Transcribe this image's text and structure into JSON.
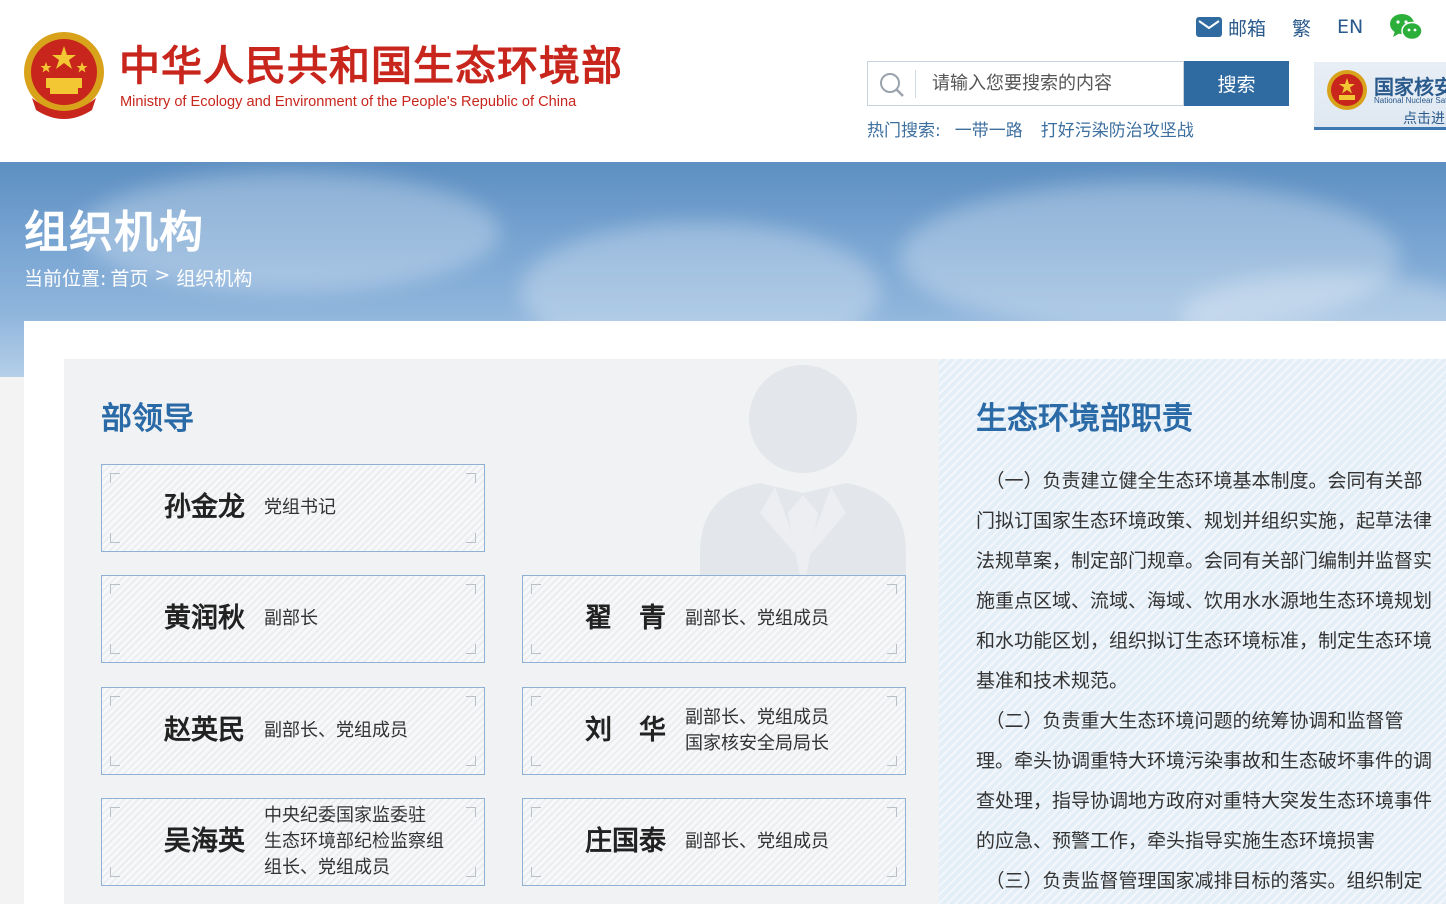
{
  "header": {
    "site_title": "中华人民共和国生态环境部",
    "site_subtitle": "Ministry of Ecology and Environment of the People's Republic of China",
    "top_links": {
      "mail": "邮箱",
      "traditional": "繁",
      "english": "EN"
    },
    "search": {
      "placeholder": "请输入您要搜索的内容",
      "button": "搜索"
    },
    "hot_search": {
      "label": "热门搜索:",
      "items": [
        "一带一路",
        "打好污染防治攻坚战"
      ]
    },
    "nnsa_banner": {
      "title": "国家核安",
      "subtitle": "National Nuclear Safety",
      "enter": "点击进入"
    }
  },
  "hero": {
    "page_title": "组织机构",
    "breadcrumb": {
      "label": "当前位置:",
      "home": "首页",
      "separator": ">",
      "current": "组织机构"
    }
  },
  "leaders": {
    "heading": "部领导",
    "items": [
      {
        "name": "孙金龙",
        "title_lines": [
          "党组书记"
        ]
      },
      {
        "name": "黄润秋",
        "title_lines": [
          "副部长"
        ]
      },
      {
        "name": "翟　青",
        "title_lines": [
          "副部长、党组成员"
        ]
      },
      {
        "name": "赵英民",
        "title_lines": [
          "副部长、党组成员"
        ]
      },
      {
        "name": "刘　华",
        "title_lines": [
          "副部长、党组成员",
          "国家核安全局局长"
        ]
      },
      {
        "name": "吴海英",
        "title_lines": [
          "中央纪委国家监委驻",
          "生态环境部纪检监察组",
          "组长、党组成员"
        ]
      },
      {
        "name": "庄国泰",
        "title_lines": [
          "副部长、党组成员"
        ]
      }
    ]
  },
  "duties": {
    "heading": "生态环境部职责",
    "paragraphs": [
      "（一）负责建立健全生态环境基本制度。会同有关部门拟订国家生态环境政策、规划并组织实施，起草法律法规草案，制定部门规章。会同有关部门编制并监督实施重点区域、流域、海域、饮用水水源地生态环境规划和水功能区划，组织拟订生态环境标准，制定生态环境基准和技术规范。",
      "（二）负责重大生态环境问题的统筹协调和监督管理。牵头协调重特大环境污染事故和生态破坏事件的调查处理，指导协调地方政府对重特大突发生态环境事件的应急、预警工作，牵头指导实施生态环境损害",
      "（三）负责监督管理国家减排目标的落实。组织制定"
    ]
  },
  "colors": {
    "brand_red": "#c8251c",
    "accent_blue": "#2f6aa1",
    "heading_blue": "#2a6aa6"
  },
  "icons": [
    "national-emblem-icon",
    "mail-icon",
    "wechat-icon",
    "search-icon",
    "person-silhouette-icon"
  ]
}
